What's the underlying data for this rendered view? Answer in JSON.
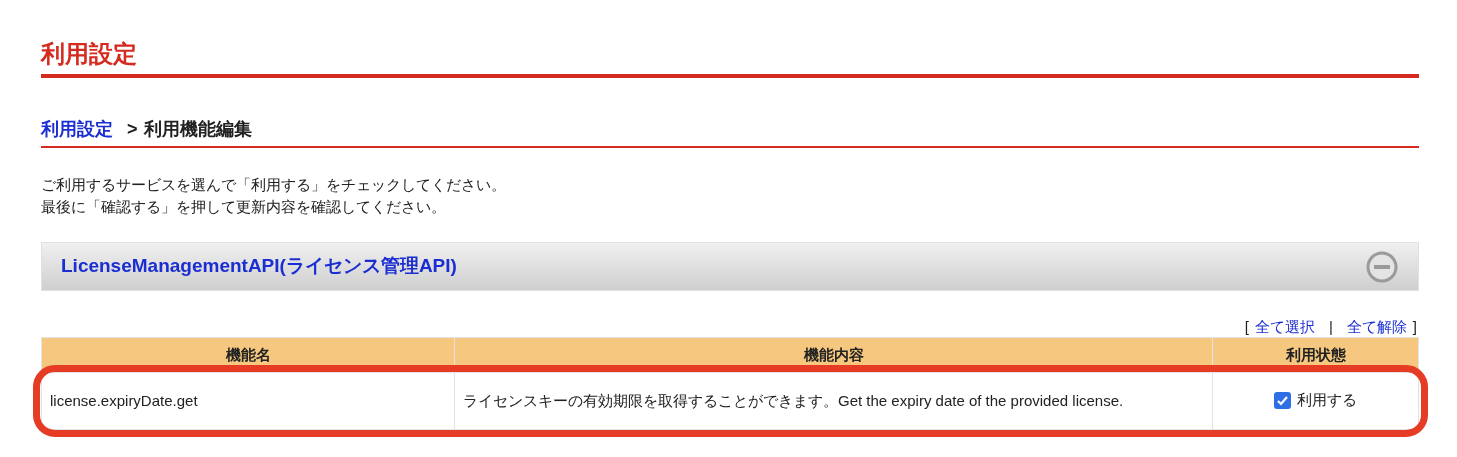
{
  "page_title": "利用設定",
  "breadcrumb": {
    "link": "利用設定",
    "separator": ">",
    "current": "利用機能編集"
  },
  "instructions": [
    "ご利用するサービスを選んで「利用する」をチェックしてください。",
    "最後に「確認する」を押して更新内容を確認してください。"
  ],
  "section": {
    "title": "LicenseManagementAPI(ライセンス管理API)",
    "expanded": true
  },
  "bulk_links": {
    "open": "[",
    "select_all": "全て選択",
    "divider": "|",
    "clear_all": "全て解除",
    "close": "]"
  },
  "table": {
    "columns": [
      "機能名",
      "機能内容",
      "利用状態"
    ],
    "rows": [
      {
        "name": "license.expiryDate.get",
        "description": "ライセンスキーの有効期限を取得することができます。Get the expiry date of the provided license.",
        "checked": true,
        "label": "利用する",
        "highlighted": true
      }
    ]
  }
}
